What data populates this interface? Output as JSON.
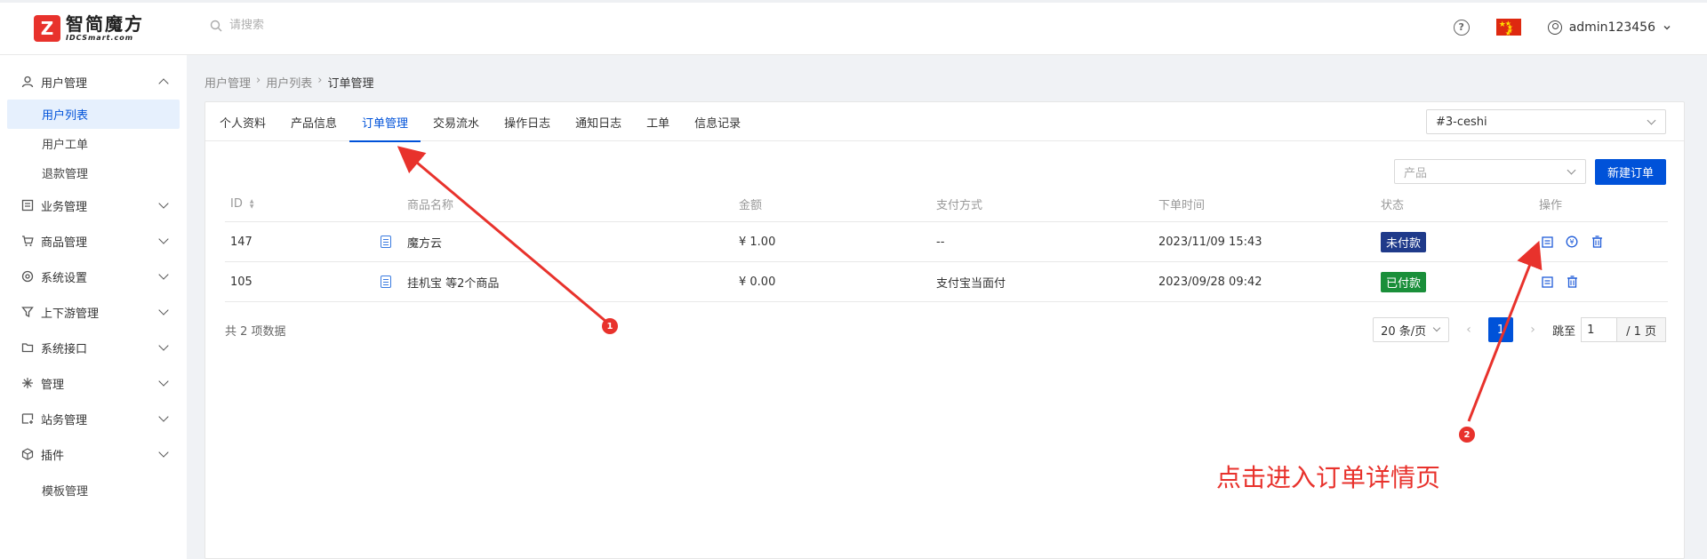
{
  "header": {
    "logo_cn": "智简魔方",
    "logo_en": "IDCSmart.com",
    "search_placeholder": "请搜索",
    "user": "admin123456"
  },
  "sidebar": {
    "groups": [
      {
        "label": "用户管理",
        "icon": "user-icon",
        "expanded": true,
        "children": [
          "用户列表",
          "用户工单",
          "退款管理"
        ],
        "active": "用户列表"
      },
      {
        "label": "业务管理",
        "icon": "list-icon"
      },
      {
        "label": "商品管理",
        "icon": "cart-icon"
      },
      {
        "label": "系统设置",
        "icon": "gear-icon"
      },
      {
        "label": "上下游管理",
        "icon": "filter-icon"
      },
      {
        "label": "系统接口",
        "icon": "folder-icon"
      },
      {
        "label": "管理",
        "icon": "sparkle-icon"
      },
      {
        "label": "站务管理",
        "icon": "site-icon"
      },
      {
        "label": "插件",
        "icon": "cube-icon"
      }
    ],
    "extra": "模板管理"
  },
  "breadcrumb": [
    "用户管理",
    "用户列表",
    "订单管理"
  ],
  "tabs": [
    "个人资料",
    "产品信息",
    "订单管理",
    "交易流水",
    "操作日志",
    "通知日志",
    "工单",
    "信息记录"
  ],
  "active_tab": "订单管理",
  "user_select": "#3-ceshi",
  "product_filter_placeholder": "产品",
  "new_order_label": "新建订单",
  "table": {
    "columns": [
      "ID",
      "商品名称",
      "金额",
      "支付方式",
      "下单时间",
      "状态",
      "操作"
    ],
    "rows": [
      {
        "id": "147",
        "name": "魔方云",
        "amount": "¥ 1.00",
        "pay": "--",
        "time": "2023/11/09 15:43",
        "status": "未付款",
        "status_color": "#1f3a8a"
      },
      {
        "id": "105",
        "name": "挂机宝 等2个商品",
        "amount": "¥ 0.00",
        "pay": "支付宝当面付",
        "time": "2023/09/28 09:42",
        "status": "已付款",
        "status_color": "#1a8f3a"
      }
    ]
  },
  "pagination": {
    "total": "共 2 项数据",
    "page_size": "20 条/页",
    "current": "1",
    "jump_label": "跳至",
    "jump_value": "1",
    "total_pages": "/ 1 页"
  },
  "annotation": {
    "text": "点击进入订单详情页",
    "marker1": "1",
    "marker2": "2",
    "color": "#e8322c"
  }
}
